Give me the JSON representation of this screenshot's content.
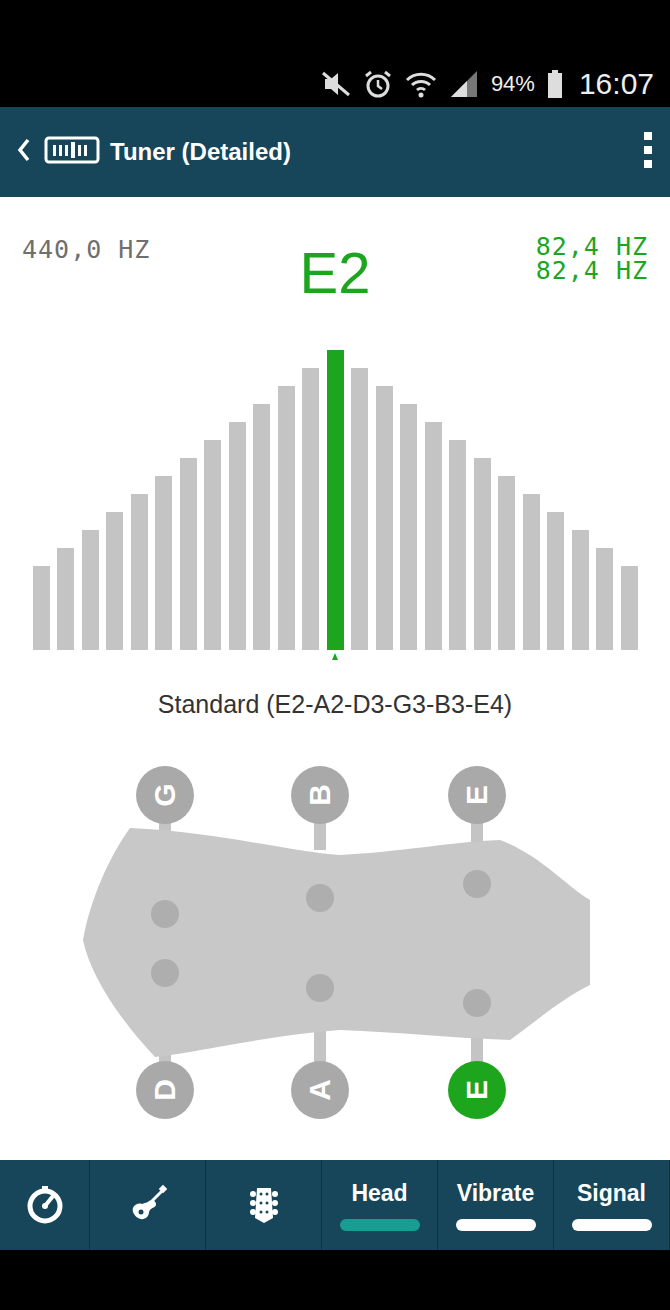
{
  "status_bar": {
    "battery": "94%",
    "time": "16:07"
  },
  "app_bar": {
    "title": "Tuner (Detailed)"
  },
  "readout": {
    "reference": "440,0 HZ",
    "note": "E2",
    "frequencies": [
      "82,4 HZ",
      "82,4 HZ"
    ]
  },
  "meter": {
    "bars": 25,
    "level": 0.5
  },
  "tuning": "Standard (E2-A2-D3-G3-B3-E4)",
  "strings": [
    {
      "label": "G",
      "selected": false
    },
    {
      "label": "B",
      "selected": false
    },
    {
      "label": "E",
      "selected": false
    },
    {
      "label": "D",
      "selected": false
    },
    {
      "label": "A",
      "selected": false
    },
    {
      "label": "E",
      "selected": true
    }
  ],
  "nav": [
    {
      "kind": "icon",
      "icon": "metronome"
    },
    {
      "kind": "icon",
      "icon": "guitar"
    },
    {
      "kind": "icon",
      "icon": "headstock"
    },
    {
      "kind": "toggle",
      "label": "Head",
      "on": true
    },
    {
      "kind": "toggle",
      "label": "Vibrate",
      "on": false
    },
    {
      "kind": "toggle",
      "label": "Signal",
      "on": false
    }
  ]
}
